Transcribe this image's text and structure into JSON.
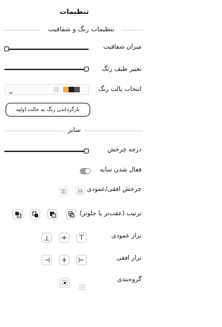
{
  "header": {
    "title": "تنظیمات"
  },
  "sections": {
    "color": "تنظیمات رنگ و شفافیت",
    "other": "سایر"
  },
  "opacity": {
    "label": "میزان شفافیت",
    "value": 0.0
  },
  "spectrum": {
    "label": "تغییر طیف رنگ",
    "value": 1.0
  },
  "palette": {
    "label": "انتخاب پالت رنگ",
    "swatches": [
      "#ffffff",
      "#e2e2e2",
      "#f5a82a",
      "#1a1a1a",
      "#555555"
    ]
  },
  "reset_button": {
    "label": "بازگرداندن رنگ به حالت اولیه"
  },
  "rotation": {
    "label": "درجه چرخش",
    "value": 1.0
  },
  "shadow": {
    "label": "فعال شدن سایه",
    "enabled": false
  },
  "flip": {
    "label": "چرخش افقی/عمودی",
    "icons": [
      "flip-horizontal-icon",
      "flip-vertical-icon"
    ]
  },
  "order": {
    "label": "ترتیب (عقب‌تر یا جلوتر)",
    "icons": [
      "bring-forward-icon",
      "bring-to-front-icon",
      "send-backward-icon",
      "send-to-back-icon"
    ]
  },
  "valign": {
    "label": "تراز عمودی",
    "icons": [
      "align-top-icon",
      "align-middle-icon",
      "align-bottom-icon"
    ]
  },
  "halign": {
    "label": "تراز افقی",
    "icons": [
      "align-left-icon",
      "align-center-icon",
      "align-right-icon"
    ]
  },
  "grouping": {
    "label": "گروه‌بندی",
    "icons": [
      "group-icon",
      "ungroup-icon"
    ]
  },
  "colors": {
    "accent": "#f5a82a",
    "text": "#111111",
    "border": "#d2d2d2"
  }
}
